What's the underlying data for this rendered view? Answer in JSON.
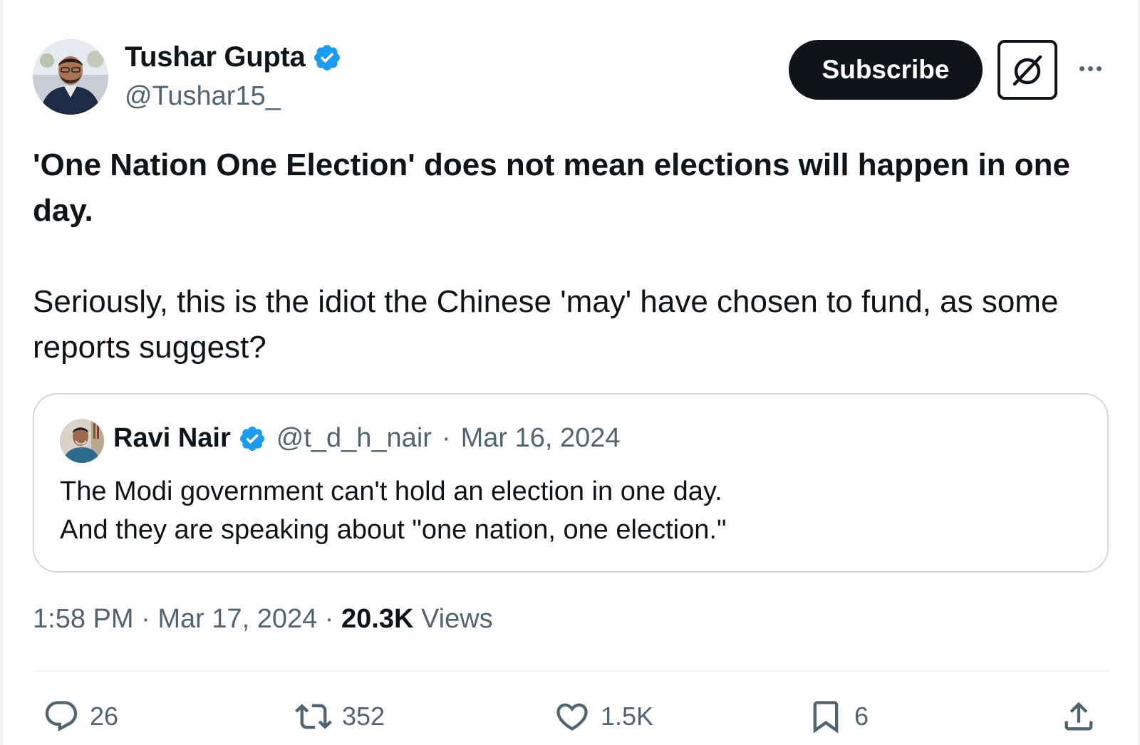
{
  "author": {
    "display_name": "Tushar Gupta",
    "handle": "@Tushar15_",
    "verified": true
  },
  "header": {
    "subscribe_label": "Subscribe",
    "grok_icon": "slashed-circle-icon",
    "more_icon": "more-dots-icon"
  },
  "tweet": {
    "bold_line": "'One Nation One Election' does not mean elections will happen in one day.",
    "body": "Seriously, this is the idiot the Chinese 'may' have chosen to fund, as some reports suggest?"
  },
  "quoted_tweet": {
    "display_name": "Ravi Nair",
    "handle": "@t_d_h_nair",
    "separator": "·",
    "date": "Mar 16, 2024",
    "line1": "The Modi government can't hold an election in one day.",
    "line2": "And they are speaking about \"one nation, one election.\""
  },
  "meta": {
    "time": "1:58 PM",
    "separator": "·",
    "date": "Mar 17, 2024",
    "views_count": "20.3K",
    "views_label": "Views"
  },
  "actions": {
    "replies": "26",
    "reposts": "352",
    "likes": "1.5K",
    "bookmarks": "6"
  },
  "colors": {
    "text_primary": "#0f1419",
    "text_secondary": "#536471",
    "verified_blue": "#1d9bf0",
    "border": "#cfd9de"
  }
}
